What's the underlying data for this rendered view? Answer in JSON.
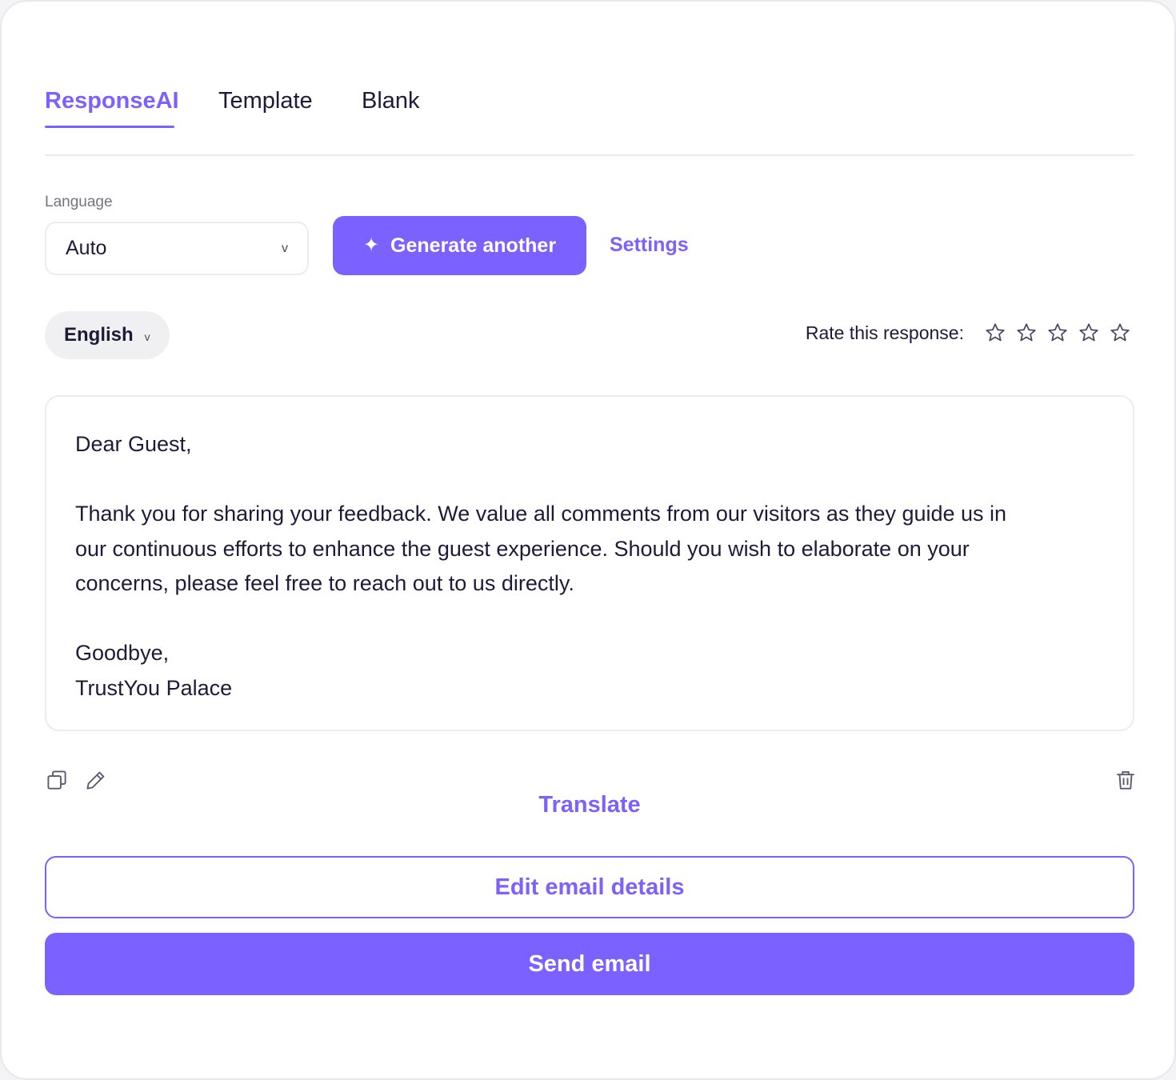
{
  "tabs": [
    {
      "label": "ResponseAI",
      "active": true
    },
    {
      "label": "Template",
      "active": false
    },
    {
      "label": "Blank",
      "active": false
    }
  ],
  "language": {
    "label": "Language",
    "selected": "Auto",
    "chevron_icon": "chevron-down-icon"
  },
  "actions": {
    "generate_label": "Generate another",
    "generate_icon": "sparkle-icon",
    "settings_label": "Settings"
  },
  "output_language": {
    "selected": "English"
  },
  "rating": {
    "label": "Rate this response:",
    "max": 5,
    "value": 0
  },
  "response": {
    "greeting": "Dear Guest,",
    "body": "Thank you for sharing your feedback. We value all comments from our visitors as they guide us in our continuous efforts to enhance the guest experience. Should you wish to elaborate on your concerns, please feel free to reach out to us directly.",
    "closing": "Goodbye,",
    "signature": "TrustYou Palace"
  },
  "toolbar": {
    "copy_icon": "copy-icon",
    "edit_icon": "pencil-icon",
    "delete_icon": "trash-icon"
  },
  "translate_label": "Translate",
  "edit_details_label": "Edit email details",
  "send_label": "Send email",
  "colors": {
    "accent": "#7b61ff",
    "text": "#1e1b3a",
    "muted": "#75737f",
    "border": "#ececef"
  }
}
